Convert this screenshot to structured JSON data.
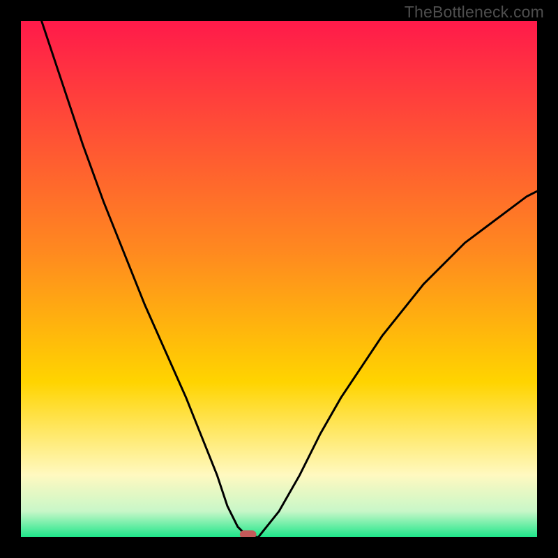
{
  "watermark": "TheBottleneck.com",
  "chart_data": {
    "type": "line",
    "title": "",
    "xlabel": "",
    "ylabel": "",
    "xlim": [
      0,
      100
    ],
    "ylim": [
      0,
      100
    ],
    "grid": false,
    "legend": false,
    "background_gradient": {
      "top_color": "#ff1a4a",
      "mid_color": "#ffd400",
      "lower_color": "#fff9c0",
      "bottom_color": "#1ee68a"
    },
    "series": [
      {
        "name": "bottleneck-curve",
        "color": "#000000",
        "x": [
          4,
          8,
          12,
          16,
          20,
          24,
          28,
          32,
          36,
          38,
          40,
          42,
          44,
          46,
          50,
          54,
          58,
          62,
          66,
          70,
          74,
          78,
          82,
          86,
          90,
          94,
          98,
          100
        ],
        "y": [
          100,
          88,
          76,
          65,
          55,
          45,
          36,
          27,
          17,
          12,
          6,
          2,
          0,
          0,
          5,
          12,
          20,
          27,
          33,
          39,
          44,
          49,
          53,
          57,
          60,
          63,
          66,
          67
        ]
      }
    ],
    "marker": {
      "name": "optimal-point",
      "shape": "rounded-rect",
      "color": "#c45a5a",
      "x": 44,
      "y": 0.5,
      "width": 3.2,
      "height": 1.6
    }
  }
}
